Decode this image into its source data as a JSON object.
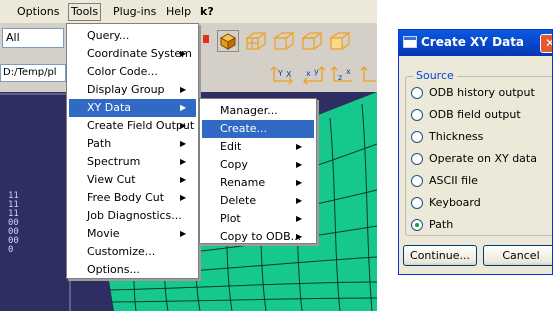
{
  "menubar": {
    "items": [
      {
        "label": "Options"
      },
      {
        "label": "Tools"
      },
      {
        "label": "Plug-ins"
      },
      {
        "label": "Help"
      },
      {
        "label": "k?"
      }
    ]
  },
  "workspace": {
    "combo_value": "All",
    "path_value": "D:/Temp/pl",
    "viewport_side_text": "1111110000000"
  },
  "tools_menu": {
    "items": [
      {
        "label": "Query...",
        "submenu": false
      },
      {
        "label": "Coordinate System",
        "submenu": true
      },
      {
        "label": "Color Code...",
        "submenu": false
      },
      {
        "label": "Display Group",
        "submenu": true
      },
      {
        "label": "XY Data",
        "submenu": true,
        "selected": true
      },
      {
        "label": "Create Field Output",
        "submenu": true
      },
      {
        "label": "Path",
        "submenu": true
      },
      {
        "label": "Spectrum",
        "submenu": true
      },
      {
        "label": "View Cut",
        "submenu": true
      },
      {
        "label": "Free Body Cut",
        "submenu": true
      },
      {
        "label": "Job Diagnostics...",
        "submenu": false
      },
      {
        "label": "Movie",
        "submenu": true
      },
      {
        "label": "Customize...",
        "submenu": false
      },
      {
        "label": "Options...",
        "submenu": false
      }
    ]
  },
  "xy_menu": {
    "items": [
      {
        "label": "Manager...",
        "submenu": false
      },
      {
        "label": "Create...",
        "submenu": false,
        "selected": true
      },
      {
        "label": "Edit",
        "submenu": true
      },
      {
        "label": "Copy",
        "submenu": true
      },
      {
        "label": "Rename",
        "submenu": true
      },
      {
        "label": "Delete",
        "submenu": true
      },
      {
        "label": "Plot",
        "submenu": true
      },
      {
        "label": "Copy to ODB...",
        "submenu": true
      }
    ]
  },
  "dialog": {
    "title": "Create XY Data",
    "close_glyph": "✕",
    "group_label": "Source",
    "options": [
      {
        "label": "ODB history output",
        "checked": false
      },
      {
        "label": "ODB field output",
        "checked": false
      },
      {
        "label": "Thickness",
        "checked": false
      },
      {
        "label": "Operate on XY data",
        "checked": false
      },
      {
        "label": "ASCII file",
        "checked": false
      },
      {
        "label": "Keyboard",
        "checked": false
      },
      {
        "label": "Path",
        "checked": true
      }
    ],
    "continue_label": "Continue...",
    "cancel_label": "Cancel"
  },
  "colors": {
    "menu_highlight": "#316ac5",
    "mesh_fill": "#17c88e",
    "viewport_bg": "#2e2e62",
    "titlebar": "#0743c8",
    "close_button": "#e35a2d"
  },
  "icons": [
    "probe-icon",
    "cube-icon",
    "wireframe-cube-icon",
    "axis-triad-icon"
  ]
}
